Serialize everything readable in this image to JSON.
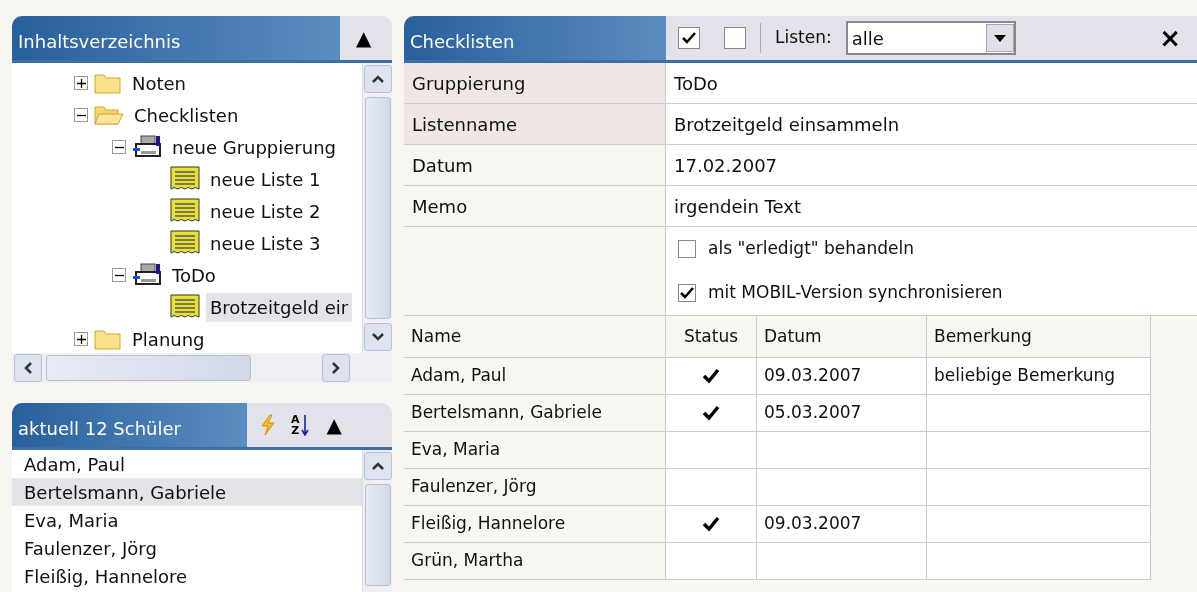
{
  "contents_panel": {
    "title": "Inhaltsverzeichnis",
    "collapse": "▲",
    "tree": [
      {
        "label": "Noten",
        "kind": "folder",
        "expanded": false,
        "selected": false
      },
      {
        "label": "Checklisten",
        "kind": "folder",
        "expanded": true,
        "selected": false,
        "children": [
          {
            "label": "neue Gruppierung",
            "kind": "group",
            "expanded": true,
            "selected": false,
            "children": [
              {
                "label": "neue Liste 1",
                "kind": "list",
                "selected": false
              },
              {
                "label": "neue Liste 2",
                "kind": "list",
                "selected": false
              },
              {
                "label": "neue Liste 3",
                "kind": "list",
                "selected": false
              }
            ]
          },
          {
            "label": "ToDo",
            "kind": "group",
            "expanded": true,
            "selected": false,
            "children": [
              {
                "label": "Brotzeitgeld eir",
                "kind": "list",
                "selected": true
              }
            ]
          }
        ]
      },
      {
        "label": "Planung",
        "kind": "folder",
        "expanded": false,
        "selected": false
      }
    ]
  },
  "students_panel": {
    "title": "aktuell 12 Schüler",
    "sort": {
      "top": "A",
      "bottom": "Z"
    },
    "collapse": "▲",
    "students": [
      {
        "name": "Adam, Paul",
        "selected": false
      },
      {
        "name": "Bertelsmann, Gabriele",
        "selected": true
      },
      {
        "name": "Eva, Maria",
        "selected": false
      },
      {
        "name": "Faulenzer, Jörg",
        "selected": false
      },
      {
        "name": "Fleißig, Hannelore",
        "selected": false
      }
    ]
  },
  "checklist_panel": {
    "title": "Checklisten",
    "toolbar_boxes": [
      {
        "checked": true
      },
      {
        "checked": false
      }
    ],
    "lists_label": "Listen:",
    "lists_value": "alle",
    "close": "×",
    "fields": [
      {
        "label": "Gruppierung",
        "value": "ToDo",
        "highlighted": true
      },
      {
        "label": "Listenname",
        "value": "Brotzeitgeld einsammeln",
        "highlighted": true
      },
      {
        "label": "Datum",
        "value": "17.02.2007",
        "highlighted": false
      },
      {
        "label": "Memo",
        "value": "irgendein Text",
        "highlighted": false
      }
    ],
    "options": [
      {
        "label": "als \"erledigt\" behandeln",
        "checked": false
      },
      {
        "label": "mit MOBIL-Version synchronisieren",
        "checked": true
      }
    ],
    "table": {
      "columns": [
        "Name",
        "Status",
        "Datum",
        "Bemerkung"
      ],
      "rows": [
        {
          "name": "Adam, Paul",
          "done": true,
          "date": "09.03.2007",
          "remark": "beliebige Bemerkung"
        },
        {
          "name": "Bertelsmann, Gabriele",
          "done": true,
          "date": "05.03.2007"
        },
        {
          "name": "Eva, Maria",
          "done": false
        },
        {
          "name": "Faulenzer, Jörg",
          "done": false
        },
        {
          "name": "Fleißig, Hannelore",
          "done": true,
          "date": "09.03.2007"
        },
        {
          "name": "Grün, Martha",
          "done": false
        }
      ]
    }
  }
}
